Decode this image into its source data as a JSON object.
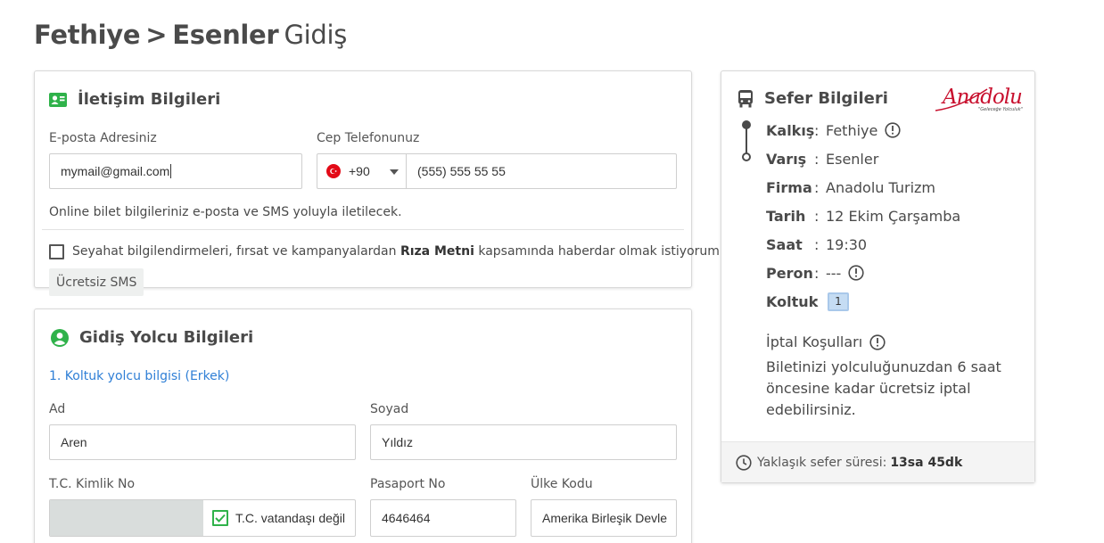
{
  "route": {
    "origin": "Fethiye",
    "separator": ">",
    "destination": "Esenler",
    "direction": "Gidiş"
  },
  "contact": {
    "title": "İletişim Bilgileri",
    "email_label": "E-posta Adresiniz",
    "email_value": "mymail@gmail.com",
    "phone_label": "Cep Telefonunuz",
    "country_code": "+90",
    "phone_placeholder": "(555) 555 55 55",
    "info_text": "Online bilet bilgileriniz e-posta ve SMS yoluyla iletilecek.",
    "consent_before": "Seyahat bilgilendirmeleri, fırsat ve kampanyalardan ",
    "consent_bold": "Rıza Metni",
    "consent_after": " kapsamında haberdar olmak istiyorum.",
    "consent_checked": false,
    "sms_tag": "Ücretsiz SMS"
  },
  "passenger": {
    "title": "Gidiş Yolcu Bilgileri",
    "seat_info": "1. Koltuk yolcu bilgisi (Erkek)",
    "first_name_label": "Ad",
    "first_name_value": "Aren",
    "last_name_label": "Soyad",
    "last_name_value": "Yıldız",
    "tc_label": "T.C. Kimlik No",
    "not_citizen_label": "T.C. vatandaşı değil",
    "not_citizen_checked": true,
    "passport_label": "Pasaport No",
    "passport_value": "4646464",
    "country_label": "Ülke Kodu",
    "country_value": "Amerika Birleşik Devle"
  },
  "trip": {
    "title": "Sefer Bilgileri",
    "logo_text": "Anadolu",
    "logo_tagline": "\"Geleceğe Yolculuk\"",
    "rows": [
      {
        "key": "Kalkış",
        "colon": ":",
        "value": "Fethiye"
      },
      {
        "key": "Varış",
        "colon": ":",
        "value": "Esenler"
      },
      {
        "key": "Firma",
        "colon": ":",
        "value": "Anadolu Turizm"
      },
      {
        "key": "Tarih",
        "colon": ":",
        "value": "12 Ekim Çarşamba"
      },
      {
        "key": "Saat",
        "colon": ":",
        "value": "19:30"
      },
      {
        "key": "Peron",
        "colon": ":",
        "value": "---"
      },
      {
        "key": "Koltuk",
        "colon": ":",
        "value": "1"
      }
    ],
    "cancel_title": "İptal Koşulları",
    "cancel_text": "Biletinizi yolculuğunuzdan 6 saat öncesine kadar ücretsiz iptal edebilirsiniz.",
    "duration_label": "Yaklaşık sefer süresi:",
    "duration_value": "13sa 45dk"
  },
  "colors": {
    "accent_green": "#2fb24a",
    "link_blue": "#2f7fd6",
    "logo_red": "#c8102e",
    "seat_blue": "#c5dcf3"
  }
}
